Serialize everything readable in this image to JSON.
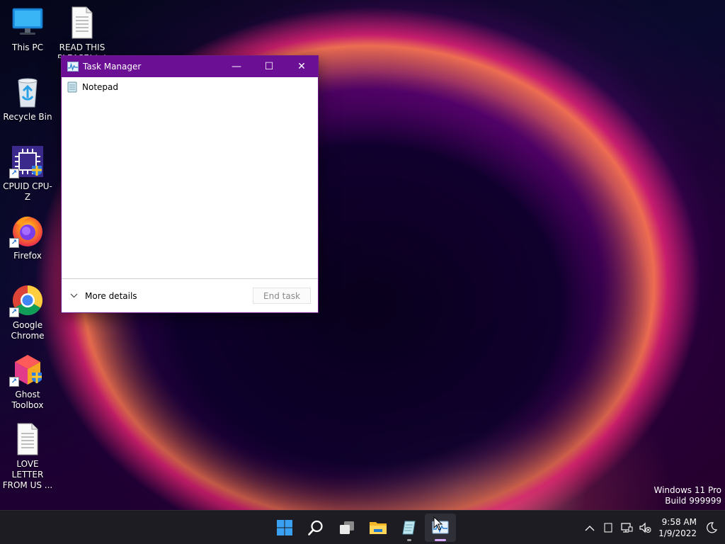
{
  "desktop": {
    "icons": [
      {
        "label": "This PC",
        "icon": "this-pc-icon"
      },
      {
        "label": "READ THIS\nPLEASE!.txt",
        "icon": "text-file-icon"
      },
      {
        "label": "Recycle Bin",
        "icon": "recycle-bin-icon"
      },
      {
        "label": "CPUID CPU-Z",
        "icon": "cpu-z-icon"
      },
      {
        "label": "Firefox",
        "icon": "firefox-icon"
      },
      {
        "label": "Google\nChrome",
        "icon": "chrome-icon"
      },
      {
        "label": "Ghost\nToolbox",
        "icon": "ghost-toolbox-icon"
      },
      {
        "label": "LOVE LETTER\nFROM US ...",
        "icon": "text-file-icon"
      }
    ]
  },
  "task_manager": {
    "title": "Task Manager",
    "controls": {
      "minimize": "—",
      "maximize": "☐",
      "close": "✕"
    },
    "processes": [
      {
        "name": "Notepad",
        "icon": "notepad-icon"
      }
    ],
    "more_details_label": "More details",
    "end_task_label": "End task"
  },
  "watermark": {
    "line1": "Windows 11 Pro",
    "line2": "Build 999999"
  },
  "taskbar": {
    "apps": [
      "start-icon",
      "search-icon",
      "task-view-icon",
      "file-explorer-icon",
      "notepad-icon",
      "task-manager-icon"
    ],
    "tray": {
      "time": "9:58 AM",
      "date": "1/9/2022"
    }
  },
  "colors": {
    "titlebar": "#6b0f94",
    "taskbar": "#1c1c22",
    "accent": "#1c6ed4",
    "indicator_active": "#d6a8ff",
    "indicator_inactive": "#9a9a9a"
  }
}
